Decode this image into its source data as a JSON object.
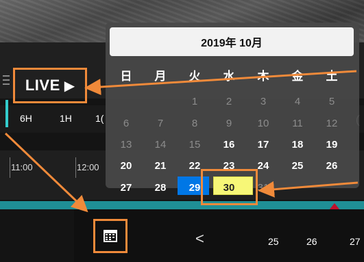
{
  "live": {
    "label": "LIVE",
    "icon": "play-triangle-icon"
  },
  "range_buttons": [
    "6H",
    "1H",
    "1("
  ],
  "timeline": {
    "labels": [
      "11:00",
      "12:00"
    ]
  },
  "calendar": {
    "month_title": "2019年 10月",
    "weekdays": [
      "日",
      "月",
      "火",
      "水",
      "木",
      "金",
      "土"
    ],
    "rows": [
      [
        "",
        "",
        "1",
        "2",
        "3",
        "4",
        "5"
      ],
      [
        "6",
        "7",
        "8",
        "9",
        "10",
        "11",
        "12"
      ],
      [
        "13",
        "14",
        "15",
        "16",
        "17",
        "18",
        "19"
      ],
      [
        "20",
        "21",
        "22",
        "23",
        "24",
        "25",
        "26"
      ],
      [
        "27",
        "28",
        "29",
        "30",
        "31",
        "",
        ""
      ]
    ],
    "selected_day": "29",
    "highlighted_day": "30",
    "colors": {
      "selected": "#0077e6",
      "today": "#f7f777",
      "annotation": "#f08a3a"
    }
  },
  "side_paren": "(",
  "bottom": {
    "calendar_button_icon": "calendar-icon",
    "prev_label": "<",
    "dates": [
      "25",
      "26",
      "27"
    ]
  }
}
